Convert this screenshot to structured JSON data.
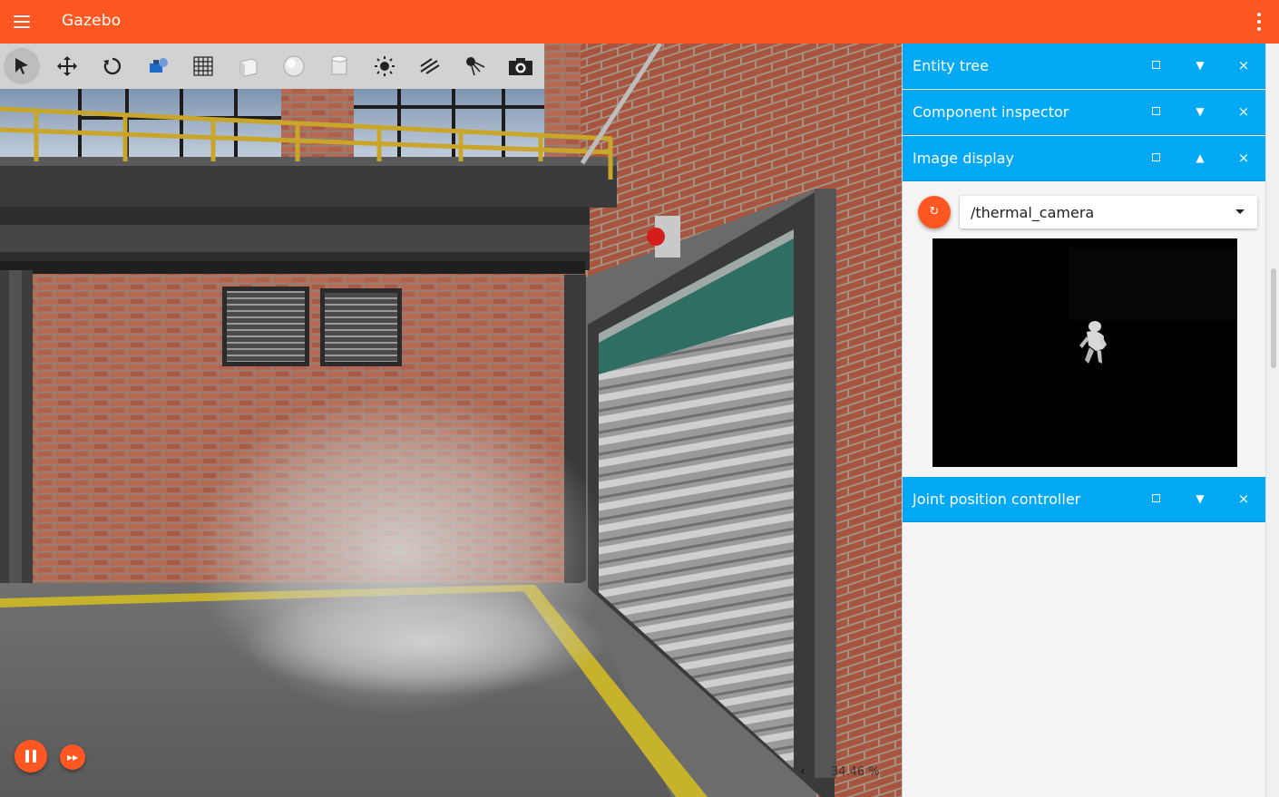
{
  "app": {
    "title": "Gazebo",
    "accent_color": "#fe5722",
    "panel_color": "#03a9f4",
    "menu_icon": "hamburger-menu-icon",
    "more_icon": "more-vertical-icon"
  },
  "toolbar": {
    "tools": [
      {
        "id": "select",
        "icon": "select-arrow-icon",
        "active": true
      },
      {
        "id": "translate",
        "icon": "translate-arrows-icon"
      },
      {
        "id": "rotate",
        "icon": "rotate-icon"
      },
      {
        "id": "transform-control",
        "icon": "transform-control-icon"
      },
      {
        "id": "grid",
        "icon": "grid-icon"
      },
      {
        "id": "box",
        "icon": "box-shape-icon"
      },
      {
        "id": "sphere",
        "icon": "sphere-shape-icon"
      },
      {
        "id": "cylinder",
        "icon": "cylinder-shape-icon"
      },
      {
        "id": "point-light",
        "icon": "point-light-icon"
      },
      {
        "id": "directional-light",
        "icon": "directional-light-icon"
      },
      {
        "id": "spot-light",
        "icon": "spot-light-icon"
      },
      {
        "id": "screenshot",
        "icon": "camera-icon"
      }
    ]
  },
  "playback": {
    "pause_icon": "pause-icon",
    "step_icon": "fast-forward-icon",
    "rtf_text": "34.46 %",
    "expand_icon": "chevron-left-icon"
  },
  "panels": [
    {
      "title": "Entity tree",
      "toggle": "▼"
    },
    {
      "title": "Component inspector",
      "toggle": "▼"
    },
    {
      "title": "Image display",
      "toggle": "▲"
    },
    {
      "title": "Joint position controller",
      "toggle": "▼"
    }
  ],
  "image_display": {
    "refresh_icon": "refresh-icon",
    "refresh_glyph": "↻",
    "topic": "/thermal_camera",
    "image_label": "thermal-camera-image"
  },
  "controls": {
    "close_glyph": "×"
  }
}
